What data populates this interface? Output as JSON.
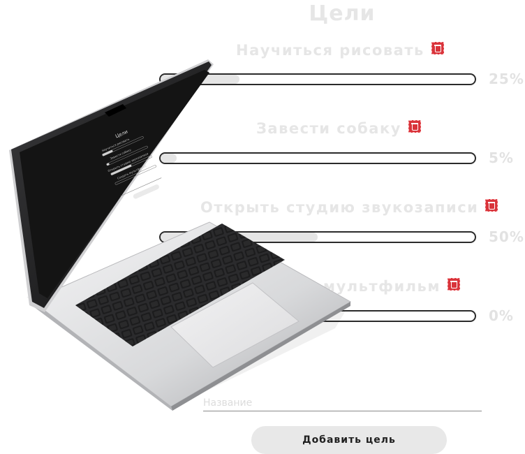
{
  "page": {
    "title": "Цели"
  },
  "goals": [
    {
      "title": "Научиться рисовать",
      "percent_label": "25%",
      "progress": 0.25
    },
    {
      "title": "Завести собаку",
      "percent_label": "5%",
      "progress": 0.05
    },
    {
      "title": "Открыть студию звукозаписи",
      "percent_label": "50%",
      "progress": 0.5
    },
    {
      "title": "Создать мультфильм",
      "percent_label": "0%",
      "progress": 0.0
    }
  ],
  "form": {
    "name_placeholder": "Название",
    "name_value": "",
    "add_label": "Добавить цель"
  },
  "icons": {
    "delete": "trash-icon",
    "laptop": "laptop-illustration"
  },
  "colors": {
    "delete_icon": "#d9343b",
    "text_faded": "#e6e6e6",
    "track_border": "#2b2b2b"
  }
}
